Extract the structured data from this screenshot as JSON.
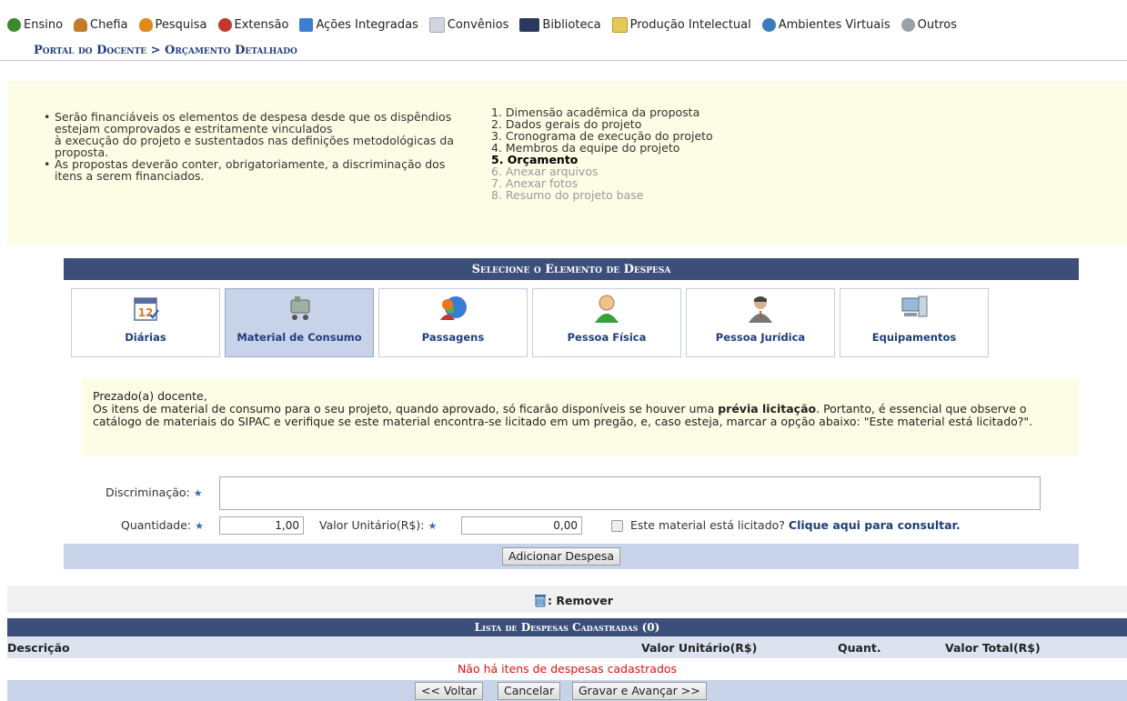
{
  "menu": {
    "items": [
      {
        "label": "Ensino",
        "icon": "ensino-icon",
        "color": "#3c8a2e"
      },
      {
        "label": "Chefia",
        "icon": "chefia-icon",
        "color": "#c77a2a"
      },
      {
        "label": "Pesquisa",
        "icon": "pesquisa-icon",
        "color": "#e08a1a"
      },
      {
        "label": "Extensão",
        "icon": "extensao-icon",
        "color": "#c0392b"
      },
      {
        "label": "Ações Integradas",
        "icon": "acoes-icon",
        "color": "#3d7dd8"
      },
      {
        "label": "Convênios",
        "icon": "convenios-icon",
        "color": "#d0d6e2"
      },
      {
        "label": "Biblioteca",
        "icon": "biblioteca-icon",
        "color": "#2a3a5c"
      },
      {
        "label": "Produção Intelectual",
        "icon": "producao-icon",
        "color": "#e8c85a"
      },
      {
        "label": "Ambientes Virtuais",
        "icon": "ambientes-icon",
        "color": "#3a7bbd"
      },
      {
        "label": "Outros",
        "icon": "outros-icon",
        "color": "#9aa0a8"
      }
    ]
  },
  "breadcrumb": "Portal do Docente > Orçamento Detalhado",
  "info": {
    "bullets": [
      "Serão financiáveis os elementos de despesa desde que os dispêndios estejam comprovados e estritamente vinculados\nà execução do projeto e sustentados nas definições metodológicas da proposta.",
      "As propostas deverão conter, obrigatoriamente, a discriminação dos itens a serem financiados."
    ],
    "steps": [
      {
        "label": "1. Dimensão acadêmica da proposta",
        "state": "done"
      },
      {
        "label": "2. Dados gerais do projeto",
        "state": "done"
      },
      {
        "label": "3. Cronograma de execução do projeto",
        "state": "done"
      },
      {
        "label": "4. Membros da equipe do projeto",
        "state": "done"
      },
      {
        "label": "5. Orçamento",
        "state": "current"
      },
      {
        "label": "6. Anexar arquivos",
        "state": "todo"
      },
      {
        "label": "7. Anexar fotos",
        "state": "todo"
      },
      {
        "label": "8. Resumo do projeto base",
        "state": "todo"
      }
    ]
  },
  "panel": {
    "title": "Selecione o Elemento de Despesa",
    "tabs": [
      {
        "label": "Diárias",
        "icon": "calendar-icon",
        "active": false
      },
      {
        "label": "Material de Consumo",
        "icon": "shopping-cart-icon",
        "active": true
      },
      {
        "label": "Passagens",
        "icon": "globe-person-icon",
        "active": false
      },
      {
        "label": "Pessoa Física",
        "icon": "person-icon",
        "active": false
      },
      {
        "label": "Pessoa Jurídica",
        "icon": "business-person-icon",
        "active": false
      },
      {
        "label": "Equipamentos",
        "icon": "computer-icon",
        "active": false
      }
    ],
    "notice_greet": "Prezado(a) docente,",
    "notice_pre": "Os itens de material de consumo para o seu projeto, quando aprovado, só ficarão disponíveis se houver uma ",
    "notice_bold": "prévia licitação",
    "notice_post": ". Portanto, é essencial que observe o catálogo de materiais do SIPAC e verifique se este material encontra-se licitado em um pregão, e, caso esteja, marcar a opção abaixo: \"Este material está licitado?\"."
  },
  "form": {
    "discriminacao_label": "Discriminação:",
    "quantidade_label": "Quantidade:",
    "quantidade_value": "1,00",
    "valor_label": "Valor Unitário(R$):",
    "valor_value": "0,00",
    "licitado_label": "Este material está licitado?",
    "consultar_link": "Clique aqui para consultar.",
    "add_button": "Adicionar Despesa"
  },
  "legend": {
    "remove_label": ": Remover"
  },
  "list": {
    "title": "Lista de Despesas Cadastradas (0)",
    "columns": {
      "descricao": "Descrição",
      "valor_unitario": "Valor Unitário(R$)",
      "quant": "Quant.",
      "valor_total": "Valor Total(R$)"
    },
    "empty": "Não há itens de despesas cadastrados"
  },
  "footer": {
    "back": "<< Voltar",
    "cancel": "Cancelar",
    "save_next": "Gravar e Avançar >>"
  }
}
